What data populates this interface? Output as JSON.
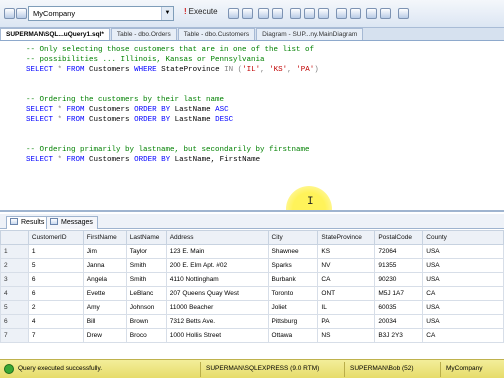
{
  "toolbar": {
    "database": "MyCompany",
    "execute_label": "Execute"
  },
  "tabs": [
    {
      "label": "SUPERMAN\\SQL...uQuery1.sql*",
      "active": true
    },
    {
      "label": "Table - dbo.Orders"
    },
    {
      "label": "Table - dbo.Customers"
    },
    {
      "label": "Diagram - SUP...ny.MainDiagram"
    }
  ],
  "editor": {
    "line1": "-- Only selecting those customers that are in one of the list of",
    "line2": "-- possibilities ... Illinois, Kansas or Pennsylvania",
    "line3_kw1": "SELECT",
    "line3_a": " * ",
    "line3_kw2": "FROM",
    "line3_b": " Customers ",
    "line3_kw3": "WHERE",
    "line3_c": " StateProvince ",
    "line3_kw4": "IN",
    "line3_d": " (",
    "line3_s1": "'IL'",
    "line3_e": ", ",
    "line3_s2": "'KS'",
    "line3_f": ", ",
    "line3_s3": "'PA'",
    "line3_g": ")",
    "line4": "-- Ordering the customers by their last name",
    "line5_kw1": "SELECT",
    "line5_a": " * ",
    "line5_kw2": "FROM",
    "line5_b": " Customers ",
    "line5_kw3": "ORDER BY",
    "line5_c": " LastName ",
    "line5_kw4": "ASC",
    "line6_kw1": "SELECT",
    "line6_a": " * ",
    "line6_kw2": "FROM",
    "line6_b": " Customers ",
    "line6_kw3": "ORDER BY",
    "line6_c": " LastName ",
    "line6_kw4": "DESC",
    "line7": "-- Ordering primarily by lastname, but secondarily by firstname",
    "line8_kw1": "SELECT",
    "line8_a": " * ",
    "line8_kw2": "FROM",
    "line8_b": " Customers ",
    "line8_kw3": "ORDER BY",
    "line8_c": " LastName, FirstName"
  },
  "results_tabs": {
    "results": "Results",
    "messages": "Messages"
  },
  "grid": {
    "columns": [
      "",
      "CustomerID",
      "FirstName",
      "LastName",
      "Address",
      "City",
      "StateProvince",
      "PostalCode",
      "County"
    ],
    "rows": [
      [
        "1",
        "1",
        "Jim",
        "Taylor",
        "123 E. Main",
        "Shawnee",
        "KS",
        "72064",
        "USA"
      ],
      [
        "2",
        "5",
        "Janna",
        "Smith",
        "200 E. Elm Apt. #02",
        "Sparks",
        "NV",
        "91355",
        "USA"
      ],
      [
        "3",
        "6",
        "Angela",
        "Smith",
        "4110 Nottingham",
        "Burbank",
        "CA",
        "90230",
        "USA"
      ],
      [
        "4",
        "6",
        "Evette",
        "LeBlanc",
        "207 Queens Quay West",
        "Toronto",
        "ONT",
        "M5J 1A7",
        "CA"
      ],
      [
        "5",
        "2",
        "Amy",
        "Johnson",
        "11000 Beacher",
        "Joliet",
        "IL",
        "60035",
        "USA"
      ],
      [
        "6",
        "4",
        "Bill",
        "Brown",
        "7312 Betts Ave.",
        "Pittsburg",
        "PA",
        "20034",
        "USA"
      ],
      [
        "7",
        "7",
        "Drew",
        "Broco",
        "1000 Hollis Street",
        "Ottawa",
        "NS",
        "B3J 2Y3",
        "CA"
      ]
    ]
  },
  "status": {
    "message": "Query executed successfully.",
    "server": "SUPERMAN\\SQLEXPRESS (9.0 RTM)",
    "user": "SUPERMAN\\Bob (52)",
    "db": "MyCompany"
  }
}
